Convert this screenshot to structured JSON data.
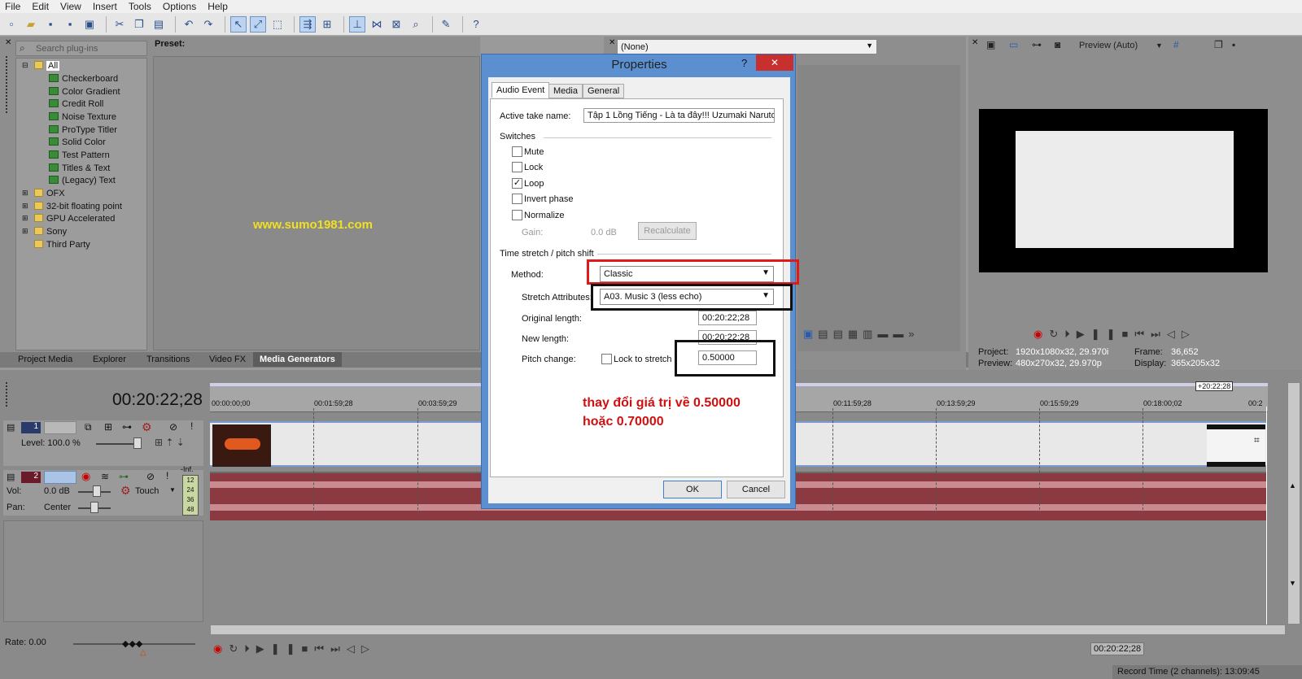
{
  "menu": [
    "File",
    "Edit",
    "View",
    "Insert",
    "Tools",
    "Options",
    "Help"
  ],
  "toolbar_icons": [
    "new-icon",
    "open-icon",
    "save-icon",
    "save-as-icon",
    "render-icon",
    "cut-icon",
    "copy-icon",
    "paste-icon",
    "undo-icon",
    "redo-icon",
    "normal-edit-tool-icon",
    "envelope-tool-icon",
    "selection-tool-icon",
    "auto-ripple-icon",
    "lock-envelopes-icon",
    "snapping-icon",
    "crossfade-icon",
    "auto-crossfade-icon",
    "zoom-tool-icon",
    "paint-icon",
    "help-icon"
  ],
  "plugins": {
    "search_placeholder": "Search plug-ins",
    "preset_label": "Preset:",
    "tree": [
      {
        "label": "All",
        "type": "folder",
        "selected": true
      },
      {
        "label": "Checkerboard",
        "type": "gen"
      },
      {
        "label": "Color Gradient",
        "type": "gen"
      },
      {
        "label": "Credit Roll",
        "type": "gen"
      },
      {
        "label": "Noise Texture",
        "type": "gen"
      },
      {
        "label": "ProType Titler",
        "type": "gen"
      },
      {
        "label": "Solid Color",
        "type": "gen"
      },
      {
        "label": "Test Pattern",
        "type": "gen"
      },
      {
        "label": "Titles & Text",
        "type": "gen"
      },
      {
        "label": "(Legacy) Text",
        "type": "gen"
      },
      {
        "label": "OFX",
        "type": "folder"
      },
      {
        "label": "32-bit floating point",
        "type": "folder"
      },
      {
        "label": "GPU Accelerated",
        "type": "folder"
      },
      {
        "label": "Sony",
        "type": "folder"
      },
      {
        "label": "Third Party",
        "type": "folder"
      }
    ],
    "watermark": "www.sumo1981.com"
  },
  "tabs": [
    "Project Media",
    "Explorer",
    "Transitions",
    "Video FX",
    "Media Generators"
  ],
  "active_tab": "Media Generators",
  "fx_panel": {
    "preset": "(None)"
  },
  "preview": {
    "mode": "Preview (Auto)",
    "project_label": "Project:",
    "project_value": "1920x1080x32, 29.970i",
    "preview_label": "Preview:",
    "preview_value": "480x270x32, 29.970p",
    "frame_label": "Frame:",
    "frame_value": "36,652",
    "display_label": "Display:",
    "display_value": "365x205x32"
  },
  "timeline": {
    "timecode": "00:20:22;28",
    "end_marker": "+20:22;28",
    "ticks": [
      "00:00:00;00",
      "00:01:59;28",
      "00:03:59;29",
      "00:11:59;28",
      "00:13:59;29",
      "00:15:59;29",
      "00:18:00;02",
      "00:2"
    ],
    "track1": {
      "number": "1",
      "level_label": "Level: 100.0 %"
    },
    "track2": {
      "number": "2",
      "vol_label": "Vol:",
      "vol_value": "0.0 dB",
      "pan_label": "Pan:",
      "pan_value": "Center",
      "touch": "Touch",
      "meter": "-Inf.",
      "meter_scale": [
        "12",
        "24",
        "36",
        "48"
      ]
    },
    "rate": "Rate: 0.00",
    "cursor_time": "00:20:22;28",
    "record_time": "Record Time (2 channels): 13:09:45"
  },
  "dialog": {
    "title": "Properties",
    "help": "?",
    "close": "✕",
    "tabs": [
      "Audio Event",
      "Media",
      "General"
    ],
    "active_take_label": "Active take name:",
    "active_take_value": "Tập 1 Lồng Tiếng - Là ta đây!!! Uzumaki Naruto",
    "switches_label": "Switches",
    "switches": [
      {
        "label": "Mute",
        "checked": false
      },
      {
        "label": "Lock",
        "checked": false
      },
      {
        "label": "Loop",
        "checked": true
      },
      {
        "label": "Invert phase",
        "checked": false
      },
      {
        "label": "Normalize",
        "checked": false
      }
    ],
    "gain_label": "Gain:",
    "gain_value": "0.0 dB",
    "recalculate": "Recalculate",
    "stretch_group": "Time stretch / pitch shift",
    "method_label": "Method:",
    "method_value": "Classic",
    "stretch_attr_label": "Stretch Attributes:",
    "stretch_attr_value": "A03. Music 3 (less echo)",
    "original_length_label": "Original length:",
    "original_length_value": "00:20:22;28",
    "new_length_label": "New length:",
    "new_length_value": "00:20:22;28",
    "pitch_label": "Pitch change:",
    "lock_stretch_label": "Lock to stretch",
    "pitch_value": "0.50000",
    "annotation_line1": "thay đổi giá trị về 0.50000",
    "annotation_line2": "hoặc 0.70000",
    "ok": "OK",
    "cancel": "Cancel"
  },
  "colors": {
    "dialog_frame": "#5b8fd0",
    "close_red": "#c7302c",
    "highlight_red": "#e01a1a",
    "annotation_red": "#d01010",
    "watermark": "#f0e020",
    "audio_wave": "#8a3a40"
  }
}
